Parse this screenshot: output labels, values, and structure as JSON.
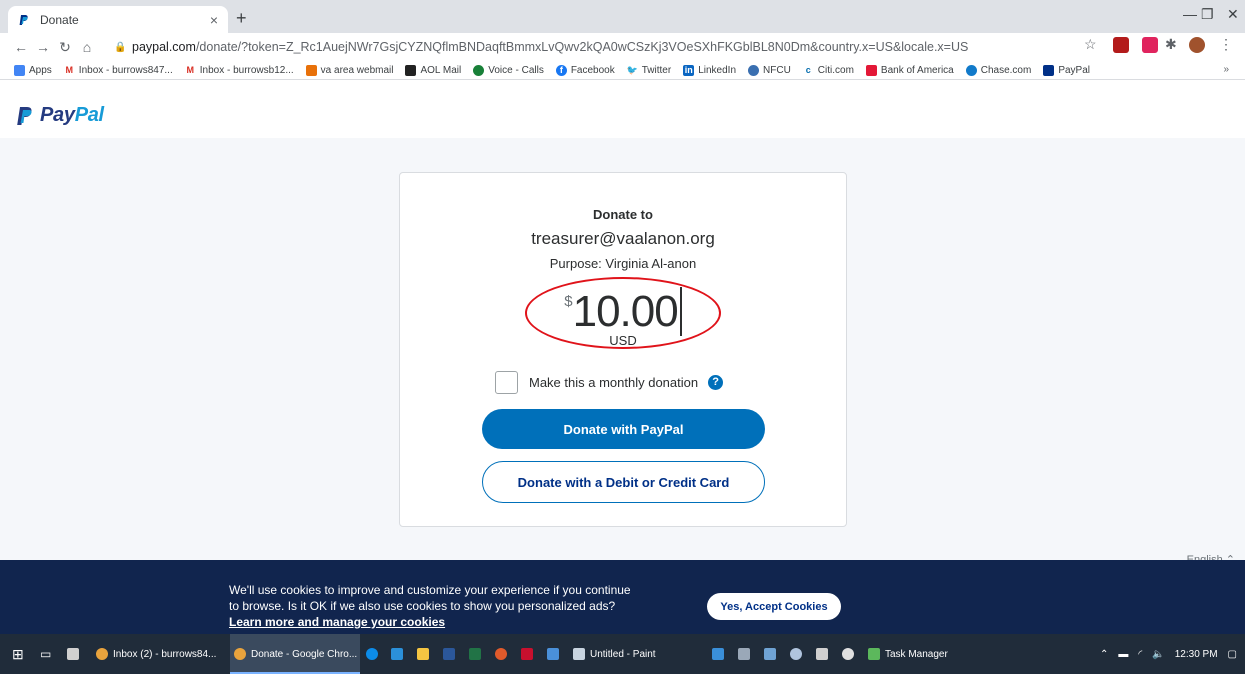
{
  "browser": {
    "tab_title": "Donate",
    "tab_close": "×",
    "new_tab": "+",
    "url_host": "paypal.com",
    "url_rest": "/donate/?token=Z_Rc1AuejNWr7GsjCYZNQflmBNDaqftBmmxLvQwv2kQA0wCSzKj3VOeSXhFKGblBL8N0Dm&country.x=US&locale.x=US"
  },
  "bookmarks": [
    {
      "label": "Apps",
      "icon": "apps-grid-icon",
      "color": "#4285f4"
    },
    {
      "label": "Inbox - burrows847...",
      "icon": "gmail-icon",
      "color": "#d93025"
    },
    {
      "label": "Inbox - burrowsb12...",
      "icon": "gmail-icon",
      "color": "#d93025"
    },
    {
      "label": "va area webmail",
      "icon": "webmail-icon",
      "color": "#e8710a"
    },
    {
      "label": "AOL Mail",
      "icon": "aol-icon",
      "color": "#222222"
    },
    {
      "label": "Voice - Calls",
      "icon": "voice-icon",
      "color": "#188038"
    },
    {
      "label": "Facebook",
      "icon": "facebook-icon",
      "color": "#1877f2"
    },
    {
      "label": "Twitter",
      "icon": "twitter-icon",
      "color": "#1da1f2"
    },
    {
      "label": "LinkedIn",
      "icon": "linkedin-icon",
      "color": "#0a66c2"
    },
    {
      "label": "NFCU",
      "icon": "nfcu-icon",
      "color": "#3a6fb0"
    },
    {
      "label": "Citi.com",
      "icon": "citi-icon",
      "color": "#056dae"
    },
    {
      "label": "Bank of America",
      "icon": "boa-icon",
      "color": "#e31837"
    },
    {
      "label": "Chase.com",
      "icon": "chase-icon",
      "color": "#117aca"
    },
    {
      "label": "PayPal",
      "icon": "paypal-icon",
      "color": "#003087"
    }
  ],
  "bookmarks_more": "»",
  "paypal": {
    "logo_part1": "Pay",
    "logo_part2": "Pal"
  },
  "donation": {
    "heading": "Donate to",
    "recipient": "treasurer@vaalanon.org",
    "purpose": "Purpose: Virginia Al-anon",
    "currency_symbol": "$",
    "amount": "10.00",
    "currency_code": "USD",
    "monthly_label": "Make this a monthly donation",
    "help": "?",
    "primary_button": "Donate with PayPal",
    "secondary_button": "Donate with a Debit or Credit Card"
  },
  "footer": {
    "language": "English ⌃"
  },
  "cookie_banner": {
    "line1": "We'll use cookies to improve and customize your experience if you continue",
    "line2": "to browse. Is it OK if we also use cookies to show you personalized ads?",
    "link": "Learn more and manage your cookies",
    "accept_button": "Yes, Accept Cookies"
  },
  "taskbar": {
    "items": [
      {
        "label": "Inbox (2) - burrows84...",
        "icon": "chrome-icon"
      },
      {
        "label": "Donate - Google Chro...",
        "icon": "chrome-icon"
      },
      {
        "label": "Untitled - Paint",
        "icon": "paint-icon"
      },
      {
        "label": "Task Manager",
        "icon": "task-manager-icon"
      }
    ],
    "clock": "12:30 PM"
  },
  "colors": {
    "paypal_blue": "#0070ba",
    "paypal_navy": "#003087",
    "highlight_red": "#e0131a",
    "cookie_bg": "#11254e"
  }
}
